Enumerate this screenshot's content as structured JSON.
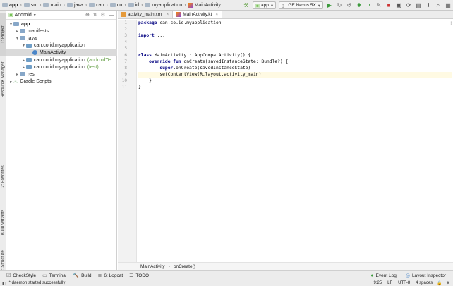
{
  "nav": {
    "crumbs": [
      "app",
      "src",
      "main",
      "java",
      "can",
      "co",
      "id",
      "myapplication",
      "MainActivity"
    ]
  },
  "toolbar": {
    "hammer": "🔨",
    "config": "app",
    "device": "LGE Nexus 5X"
  },
  "left_strip": [
    "1: Project",
    "Resource Manager",
    "2: Favorites",
    "Build Variants",
    "Z: Structure"
  ],
  "project": {
    "view": "Android",
    "tree": [
      {
        "label": "app",
        "depth": 0,
        "arrow": "▾",
        "icon": "blue",
        "bold": true
      },
      {
        "label": "manifests",
        "depth": 1,
        "arrow": "▸",
        "icon": "blue"
      },
      {
        "label": "java",
        "depth": 1,
        "arrow": "▾",
        "icon": "blue"
      },
      {
        "label": "can.co.id.myapplication",
        "depth": 2,
        "arrow": "▾",
        "icon": "pkg"
      },
      {
        "label": "MainActivity",
        "depth": 3,
        "arrow": "",
        "icon": "kt",
        "selected": true
      },
      {
        "label": "can.co.id.myapplication",
        "suffix": "(androidTe",
        "depth": 2,
        "arrow": "▸",
        "icon": "pkg"
      },
      {
        "label": "can.co.id.myapplication",
        "suffix": "(test)",
        "depth": 2,
        "arrow": "▸",
        "icon": "pkg"
      },
      {
        "label": "res",
        "depth": 1,
        "arrow": "▸",
        "icon": "blue"
      },
      {
        "label": "Gradle Scripts",
        "depth": 0,
        "arrow": "▸",
        "icon": "gradle"
      }
    ]
  },
  "editor": {
    "tabs": [
      {
        "label": "activity_main.xml",
        "active": false
      },
      {
        "label": "MainActivity.kt",
        "active": true
      }
    ],
    "lines": [
      {
        "n": "1",
        "text": "package can.co.id.myapplication",
        "kw": "package"
      },
      {
        "n": "2",
        "text": ""
      },
      {
        "n": "3",
        "text": "import ...",
        "kw": "import"
      },
      {
        "n": "4",
        "text": ""
      },
      {
        "n": "5",
        "text": ""
      },
      {
        "n": "6",
        "text": "class MainActivity : AppCompatActivity() {",
        "kw": "class"
      },
      {
        "n": "7",
        "text": "    override fun onCreate(savedInstanceState: Bundle?) {",
        "kw": "override fun"
      },
      {
        "n": "8",
        "text": "        super.onCreate(savedInstanceState)",
        "kw": "super"
      },
      {
        "n": "9",
        "text": "        setContentView(R.layout.activity_main)",
        "current": true
      },
      {
        "n": "10",
        "text": "    }"
      },
      {
        "n": "11",
        "text": "}"
      }
    ],
    "breadcrumb": [
      "MainActivity",
      "onCreate()"
    ]
  },
  "bottom_tabs": [
    {
      "label": "CheckStyle",
      "icon": "☑"
    },
    {
      "label": "Terminal",
      "icon": "▭"
    },
    {
      "label": "Build",
      "icon": "🔨"
    },
    {
      "label": "6: Logcat",
      "icon": "≣"
    },
    {
      "label": "TODO",
      "icon": "☰"
    }
  ],
  "bottom_right": [
    {
      "label": "Event Log",
      "icon": "●"
    },
    {
      "label": "Layout Inspector",
      "icon": "◎"
    }
  ],
  "status": {
    "message": "* daemon started successfully",
    "position": "9:25",
    "line_sep": "LF",
    "encoding": "UTF-8",
    "indent": "4 spaces"
  }
}
